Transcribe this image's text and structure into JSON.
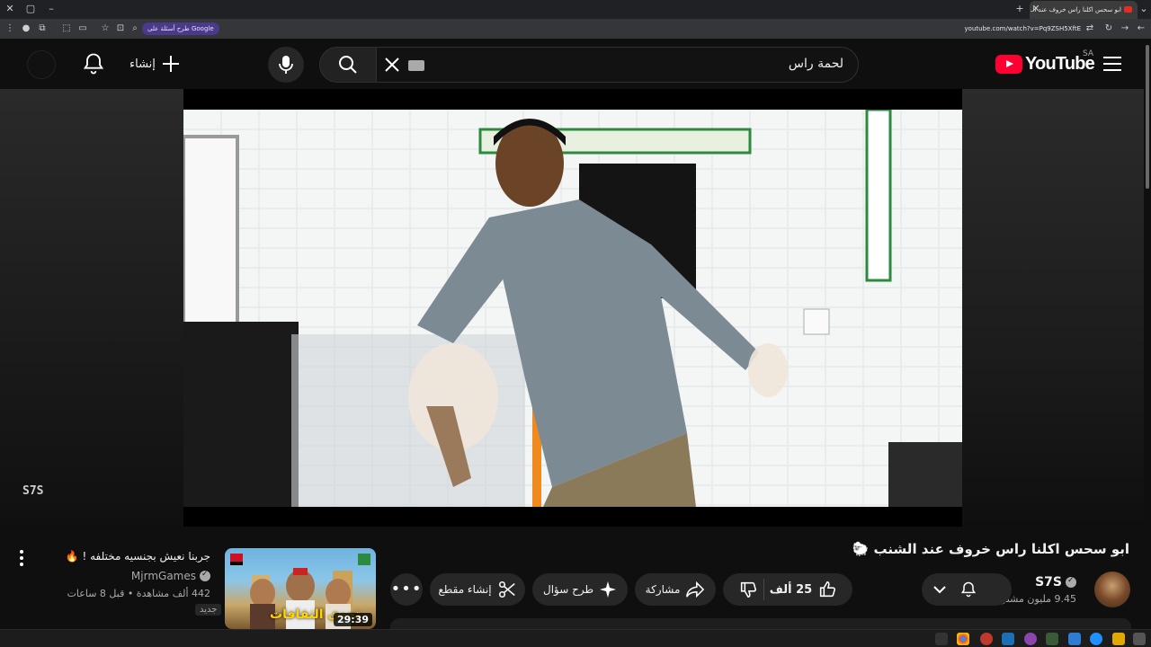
{
  "browser": {
    "tab_title": "ابو سحس اكلنا راس خروف عند الـ",
    "url": "youtube.com/watch?v=Pq9ZSH5XftE",
    "google_pill": "طرح أسئلة على Google"
  },
  "masthead": {
    "create_label": "إنشاء",
    "search_value": "لحمة راس",
    "logo_text": "YouTube",
    "country_code": "SA"
  },
  "video": {
    "watermark": "S7S",
    "title": "ابو سحس اكلنا راس خروف عند الشنب 🐑",
    "channel_name": "S7S",
    "subscribers": "9.45 مليون مشترك",
    "likes": "25 ألف",
    "share_label": "مشاركة",
    "ask_label": "طرح سؤال",
    "clip_label": "إنشاء مقطع"
  },
  "suggestion": {
    "title": "جربنا نعيش بجنسيه مختلفه ! 🔥",
    "channel": "MjrmGames",
    "meta": "442 ألف مشاهدة • قبل 8 ساعات",
    "badge": "جديد",
    "duration": "29:39",
    "thumb_text": "تحدي الثقافات"
  },
  "colors": {
    "brand_red": "#ff0033",
    "background": "#0f0f0f",
    "pill": "#272727"
  }
}
